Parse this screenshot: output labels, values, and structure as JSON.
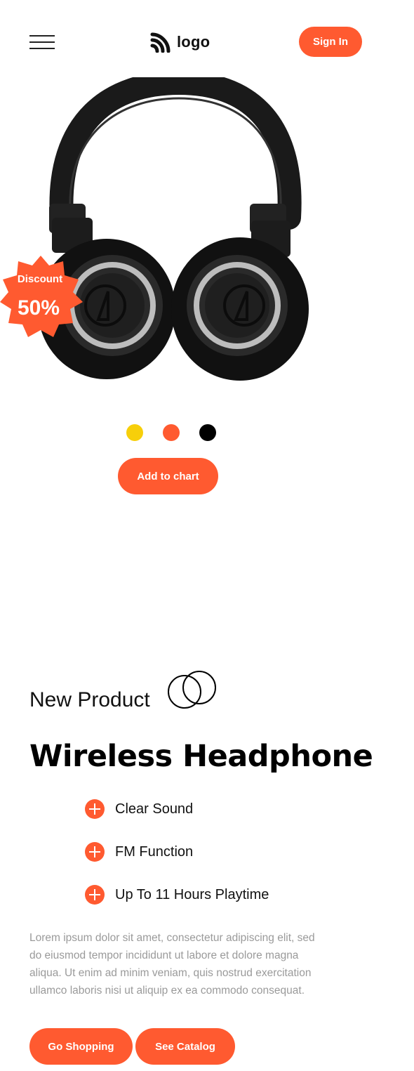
{
  "header": {
    "menu_icon": "hamburger-menu-icon",
    "logo_icon": "signal-waves-icon",
    "logo_text": "logo",
    "signin_label": "Sign In"
  },
  "hero": {
    "image": "black-over-ear-headphones",
    "badge": {
      "label": "Discount",
      "value": "50%"
    },
    "colors": [
      "#F7CF0A",
      "#FF5A30",
      "#000000"
    ],
    "add_to_cart_label": "Add to chart"
  },
  "product": {
    "eyebrow": "New Product",
    "eyebrow_icon": "overlapping-circles-icon",
    "title": "Wireless Headphone",
    "features": [
      {
        "icon": "plus-circle-icon",
        "label": "Clear Sound"
      },
      {
        "icon": "plus-circle-icon",
        "label": "FM Function"
      },
      {
        "icon": "plus-circle-icon",
        "label": "Up To 11 Hours Playtime"
      }
    ],
    "description": "Lorem ipsum dolor sit amet, consectetur adipiscing elit, sed do eiusmod tempor incididunt ut labore et dolore magna aliqua. Ut enim ad minim veniam, quis nostrud exercitation ullamco laboris nisi ut aliquip ex ea commodo consequat.",
    "primary_cta": "Go Shopping",
    "secondary_cta": "See Catalog"
  },
  "theme": {
    "accent": "#FF5A30"
  }
}
